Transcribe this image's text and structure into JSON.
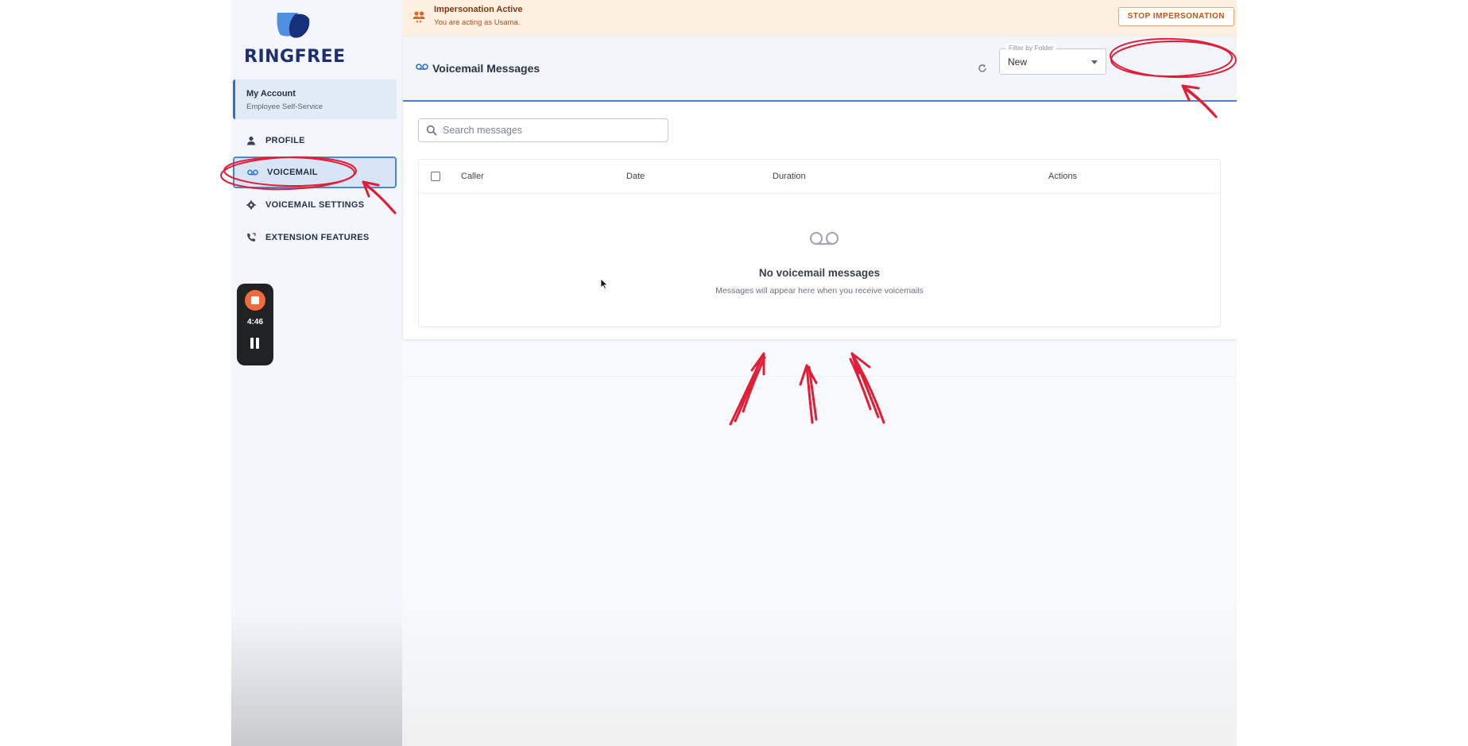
{
  "brand": {
    "name": "RINGFREE"
  },
  "sidebar": {
    "account": {
      "title": "My Account",
      "subtitle": "Employee Self-Service"
    },
    "items": [
      {
        "label": "PROFILE",
        "icon": "person-icon",
        "active": false
      },
      {
        "label": "VOICEMAIL",
        "icon": "voicemail-icon",
        "active": true
      },
      {
        "label": "VOICEMAIL SETTINGS",
        "icon": "gear-icon",
        "active": false
      },
      {
        "label": "EXTENSION FEATURES",
        "icon": "phone-forward-icon",
        "active": false
      }
    ],
    "recorder": {
      "time": "4:46"
    }
  },
  "banner": {
    "title": "Impersonation Active",
    "subtitle": "You are acting as Usama.",
    "stop_label": "STOP IMPERSONATION"
  },
  "voicemail": {
    "title": "Voicemail Messages",
    "filter": {
      "label": "Filter by Folder",
      "value": "New"
    },
    "search": {
      "placeholder": "Search messages"
    },
    "table": {
      "columns": [
        "Caller",
        "Date",
        "Duration",
        "Actions"
      ],
      "rows": []
    },
    "empty": {
      "title": "No voicemail messages",
      "subtitle": "Messages will appear here when you receive voicemails"
    }
  },
  "colors": {
    "accent": "#3f86d8",
    "brand_navy": "#1d2f6f",
    "warning_bg": "#fdf0e1",
    "warning_text": "#b14f14",
    "annotation_red": "#e01e37"
  }
}
